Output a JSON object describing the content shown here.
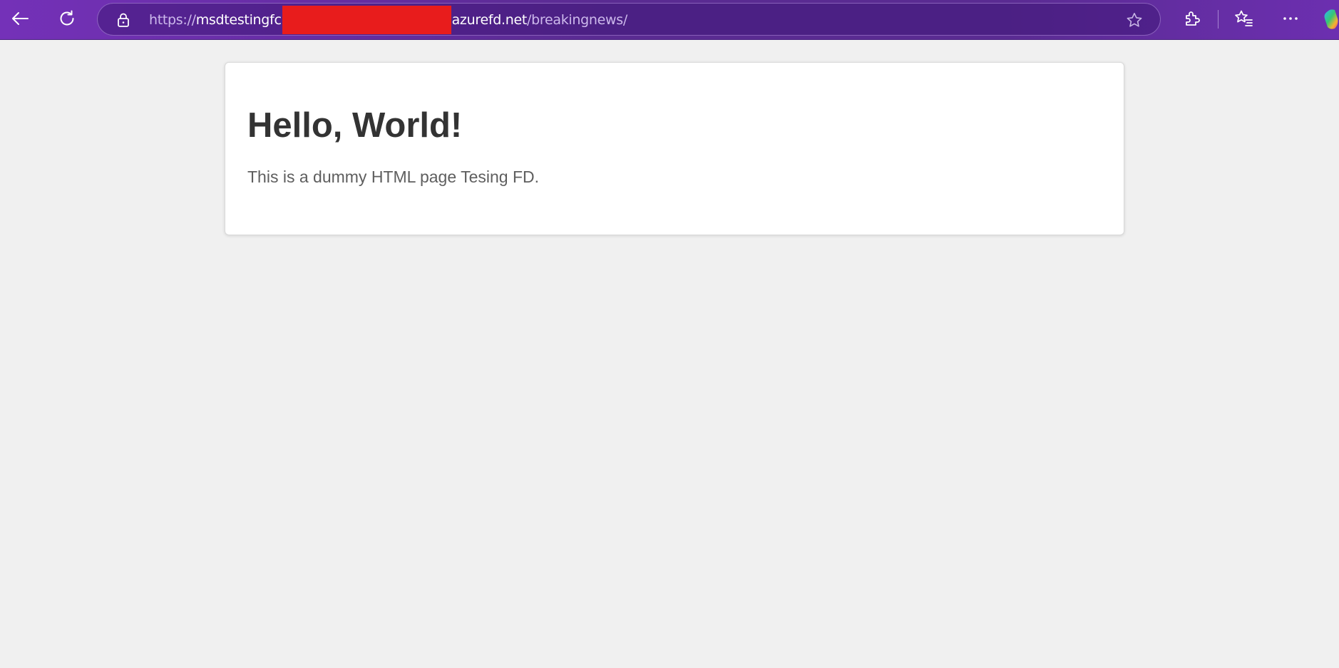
{
  "browser": {
    "url": {
      "scheme": "https://",
      "host_start": "msdtestingfc",
      "host_end": "azurefd.net",
      "path": "/breakingnews/"
    },
    "icons": {
      "back": "back-arrow-icon",
      "refresh": "refresh-icon",
      "lock": "lock-icon",
      "favorite": "star-icon",
      "extensions": "puzzle-icon",
      "favorites": "favorites-star-list-icon",
      "more": "more-dots-icon",
      "copilot": "copilot-icon"
    },
    "colors": {
      "toolbar": "#5a2b92",
      "redaction": "#e81c1c"
    }
  },
  "page": {
    "heading": "Hello, World!",
    "body": "This is a dummy HTML page Tesing FD."
  }
}
